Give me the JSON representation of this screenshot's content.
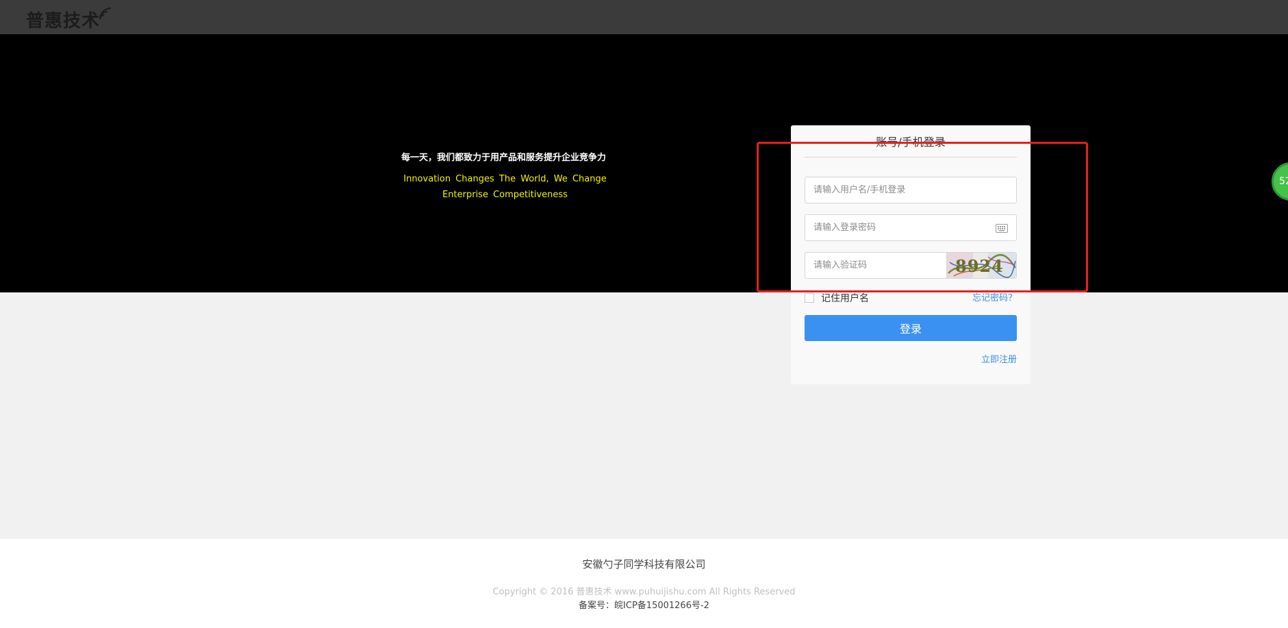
{
  "header": {
    "logo_text": "普惠技术"
  },
  "hero": {
    "slogan_cn": "每一天，我们都致力于用产品和服务提升企业竞争力",
    "slogan_en_line1": "Innovation Changes The World, We Change",
    "slogan_en_line2": "Enterprise Competitiveness"
  },
  "login": {
    "title": "账号/手机登录",
    "username_placeholder": "请输入用户名/手机登录",
    "password_placeholder": "请输入登录密码",
    "captcha_placeholder": "请输入验证码",
    "captcha_text": "8924",
    "remember_label": "记住用户名",
    "forgot_label": "忘记密码？",
    "submit_label": "登录",
    "register_label": "立即注册"
  },
  "float_badge": {
    "label": "52"
  },
  "footer": {
    "company": "安徽勺子同学科技有限公司",
    "copyright": "Copyright © 2016 普惠技术 www.puhuijishu.com All Rights Reserved",
    "icp": "备案号：皖ICP备15001266号-2"
  },
  "colors": {
    "topbar": "#3b3b3b",
    "hero": "#000000",
    "accent_blue": "#3a91f2",
    "slogan_yellow": "#f5f500",
    "highlight_red": "#e8201b",
    "badge_green": "#45c24a"
  }
}
